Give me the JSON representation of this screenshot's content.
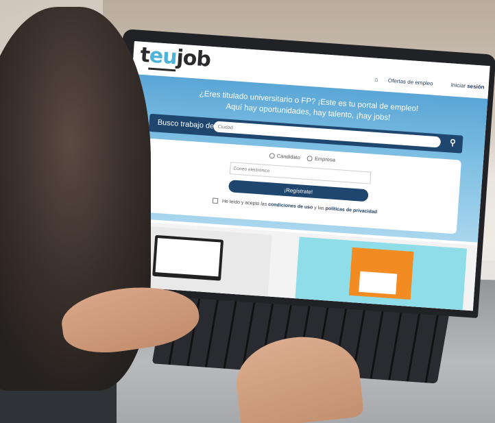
{
  "brand": {
    "logo_part1": "t",
    "logo_part2": "eu",
    "logo_part3": "job",
    "accent": "#4fb3d9",
    "dark": "#1f466e"
  },
  "nav": {
    "home_icon": "home-icon",
    "offers": "Ofertas de empleo",
    "login_prefix": "Iniciar",
    "login_bold": "sesión"
  },
  "hero": {
    "tagline_line1": "¿Eres titulado universitario o FP? ¡Este es tu portal de empleo!",
    "tagline_line2": "Aquí hay oportunidades, hay talento, ¡hay jobs!",
    "search_label": "Busco trabajo de",
    "city_placeholder": "Ciudad"
  },
  "register": {
    "option_candidate": "Candidato",
    "option_company": "Empresa",
    "email_placeholder": "Correo electrónico",
    "button": "¡Regístrate!",
    "terms_prefix": "He leído y acepto las",
    "terms_link1": "condiciones de uso",
    "terms_and": "y las",
    "terms_link2": "políticas de privacidad"
  }
}
